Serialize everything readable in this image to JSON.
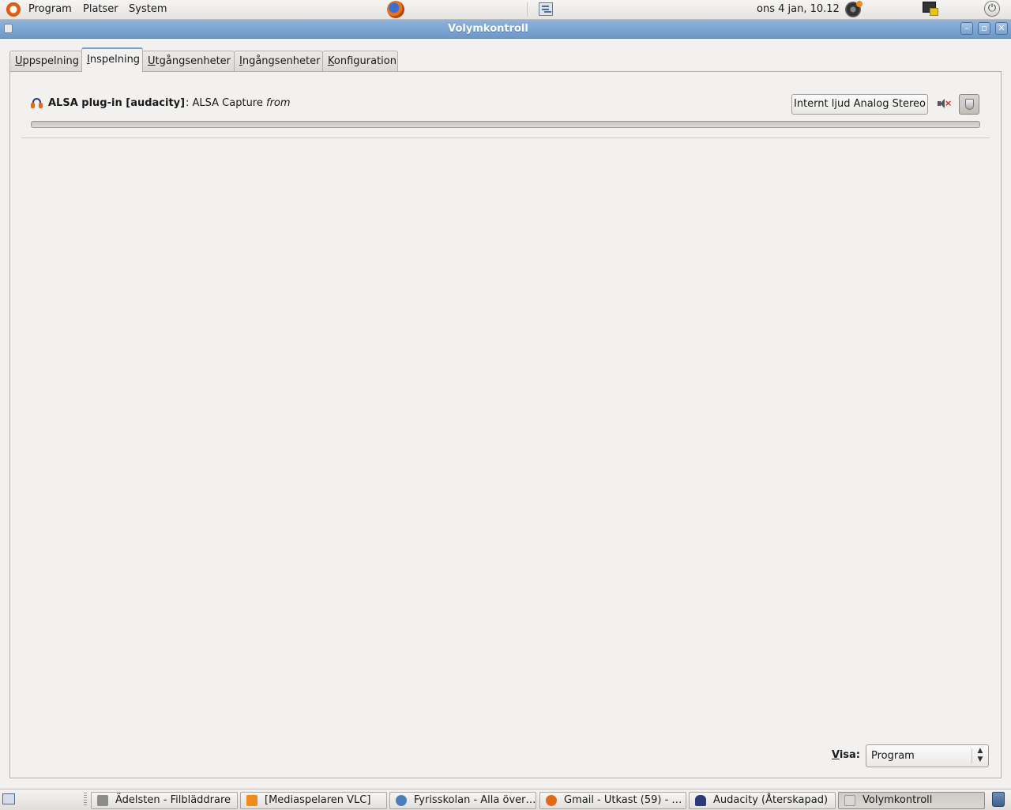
{
  "top_panel": {
    "menus": [
      "Program",
      "Platser",
      "System"
    ],
    "clock": "ons  4 jan, 10.12"
  },
  "window": {
    "title": "Volymkontroll"
  },
  "tabs": [
    {
      "label": "Uppspelning",
      "mnemonic": "U",
      "rest": "ppspelning",
      "active": false
    },
    {
      "label": "Inspelning",
      "mnemonic": "I",
      "rest": "nspelning",
      "active": true
    },
    {
      "label": "Utgångsenheter",
      "mnemonic": "U",
      "rest": "tgångsenheter",
      "active": false
    },
    {
      "label": "Ingångsenheter",
      "mnemonic": "I",
      "rest": "ngångsenheter",
      "active": false
    },
    {
      "label": "Konfiguration",
      "mnemonic": "K",
      "rest": "onfiguration",
      "active": false
    }
  ],
  "stream": {
    "app_name": "ALSA plug-in [audacity]",
    "separator": ": ",
    "description": "ALSA Capture ",
    "description_italic": "from",
    "device_button": "Internt ljud Analog Stereo"
  },
  "visa": {
    "label_mnemonic": "V",
    "label_rest": "isa:",
    "value": "Program"
  },
  "taskbar": {
    "tasks": [
      {
        "label": "Ädelsten - Filbläddrare",
        "icon_color": "#8c8c8c"
      },
      {
        "label": "[Mediaspelaren VLC]",
        "icon_color": "#f08a1c"
      },
      {
        "label": "Fyrisskolan - Alla över…",
        "icon_color": "#4a7fb8"
      },
      {
        "label": "Gmail - Utkast (59) - …",
        "icon_color": "#e06a18"
      },
      {
        "label": "Audacity (Återskapad)",
        "icon_color": "#2a3a7a"
      },
      {
        "label": "Volymkontroll",
        "icon_color": "#d8d8d8",
        "active": true
      }
    ]
  }
}
